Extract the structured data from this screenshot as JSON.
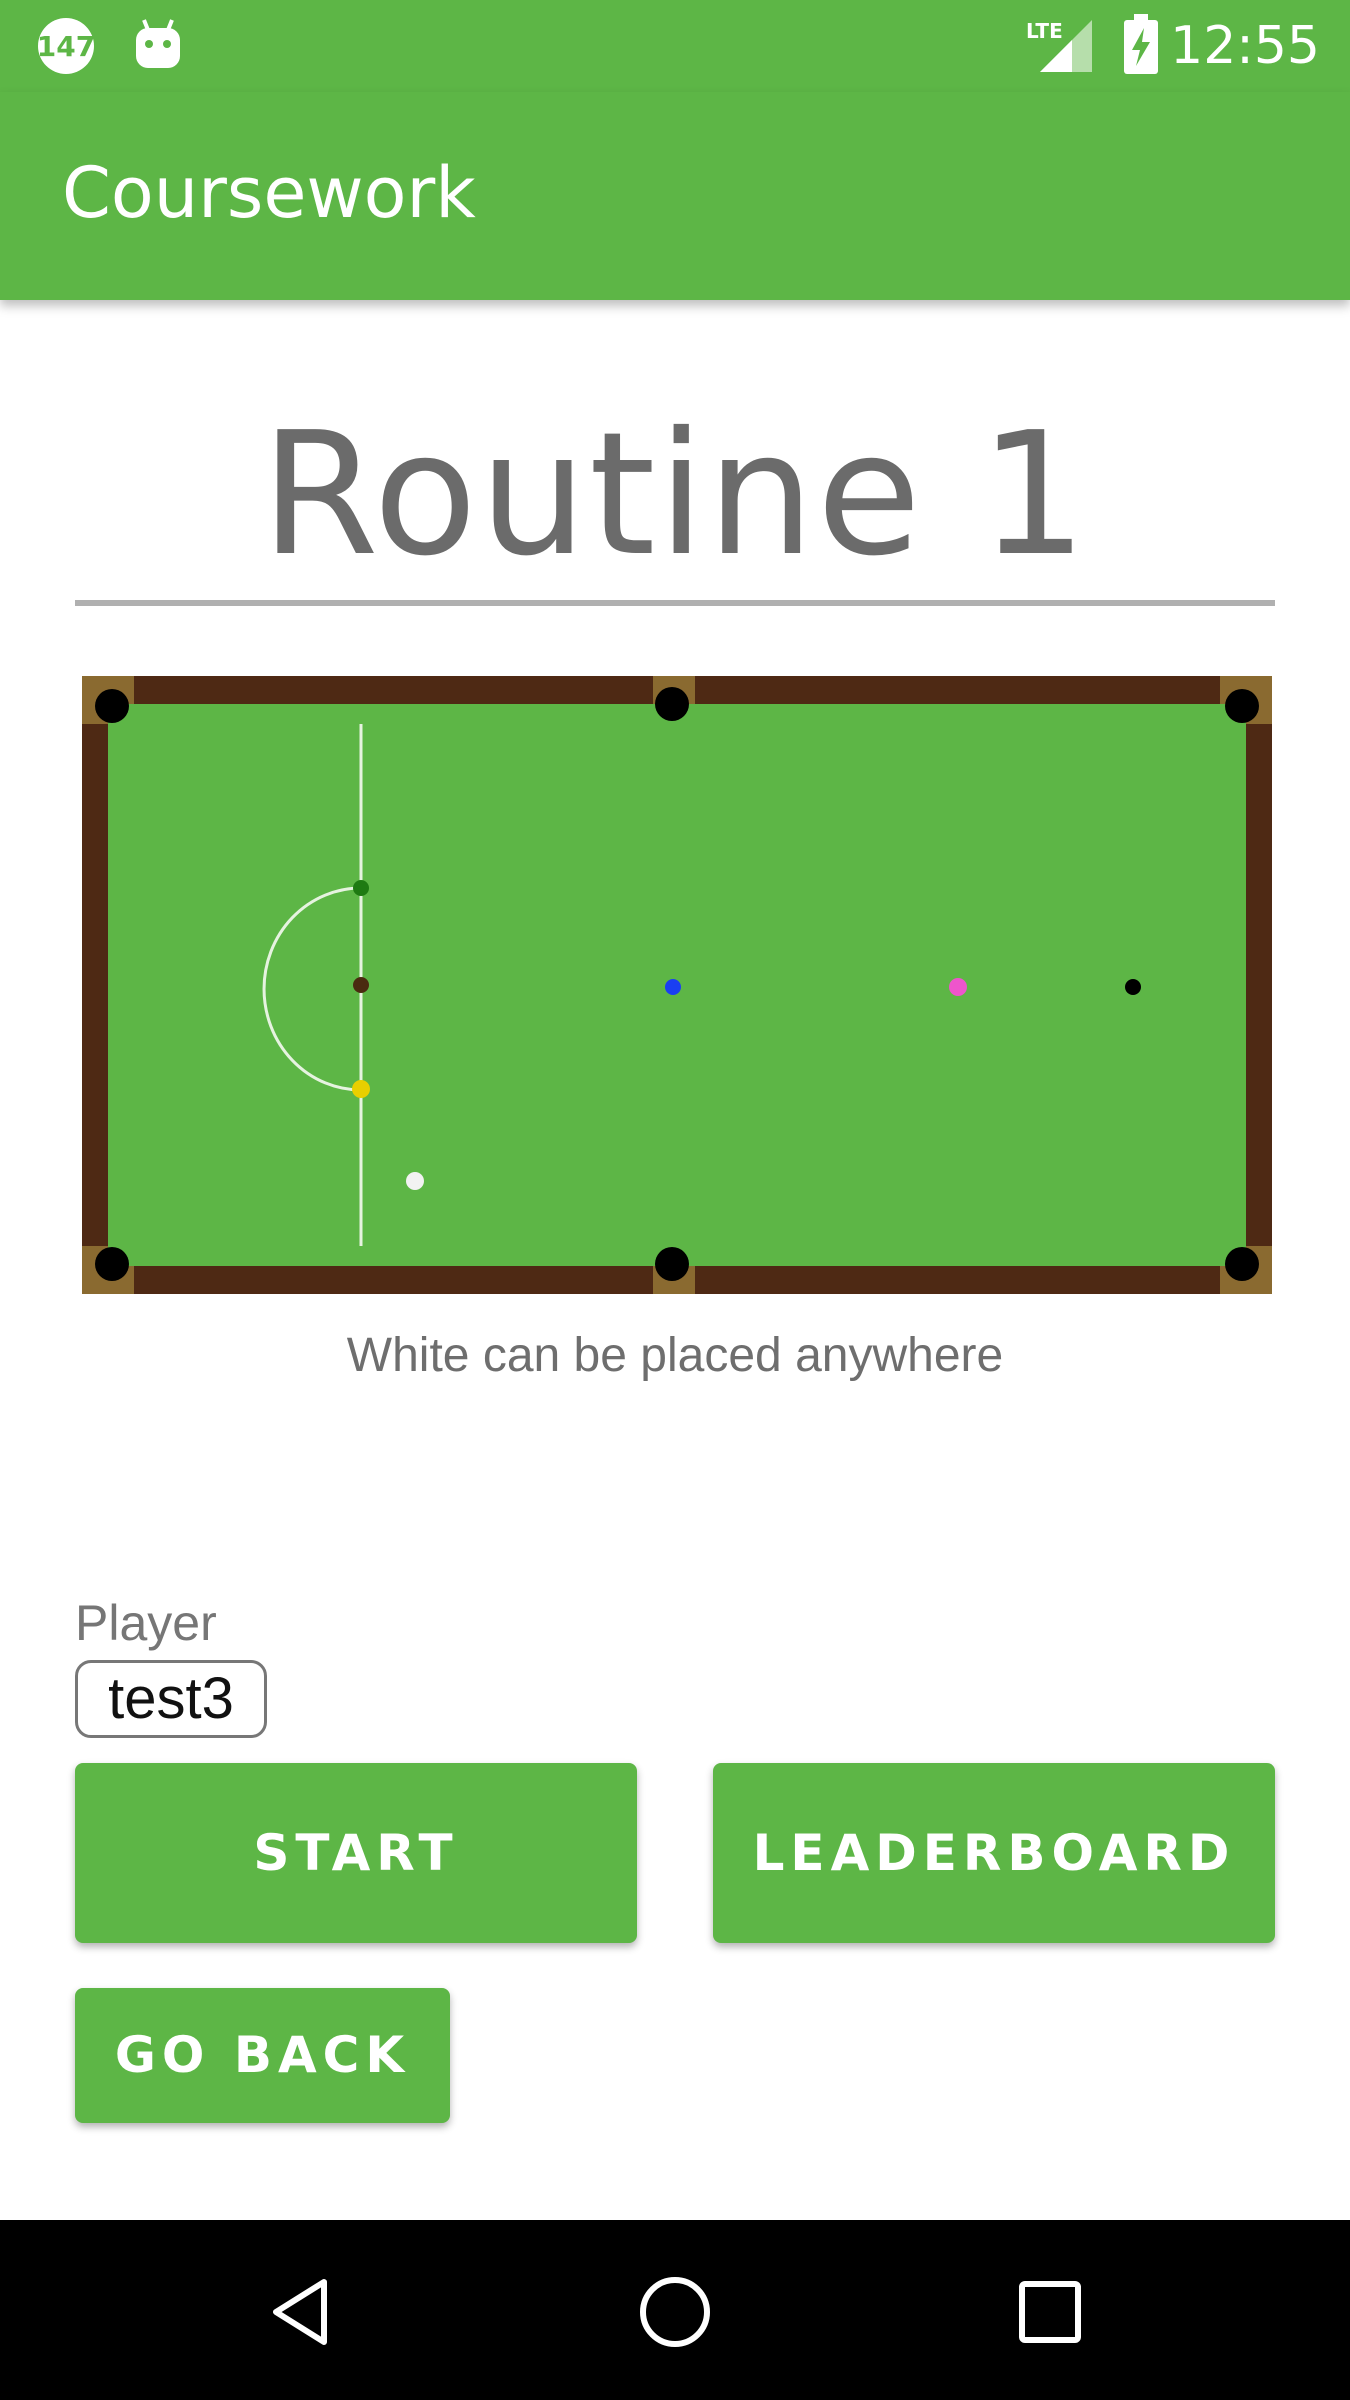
{
  "status_bar": {
    "left_icons": [
      "notification-147-icon",
      "android-debug-icon"
    ],
    "signal_label": "LTE",
    "time": "12:55",
    "background": "#5db646"
  },
  "app_bar": {
    "title": "Coursework",
    "background": "#5db646"
  },
  "routine": {
    "title": "Routine 1",
    "caption": "White can be placed anywhere"
  },
  "table": {
    "felt_color": "#5db646",
    "cushion_color": "#4e2914",
    "balls": [
      "green",
      "brown",
      "yellow",
      "blue",
      "pink",
      "black",
      "white"
    ],
    "ball_colors": {
      "green": "#1e7a12",
      "brown": "#4a2a10",
      "yellow": "#e8cf00",
      "blue": "#1a3ff2",
      "pink": "#ee55cc",
      "black": "#000000",
      "white": "#f2f2f2"
    }
  },
  "player": {
    "label": "Player",
    "value": "test3"
  },
  "buttons": {
    "start": "START",
    "leaderboard": "LEADERBOARD",
    "go_back": "GO BACK"
  },
  "nav_bar": {
    "icons": [
      "back-triangle-icon",
      "home-circle-icon",
      "recents-square-icon"
    ]
  }
}
